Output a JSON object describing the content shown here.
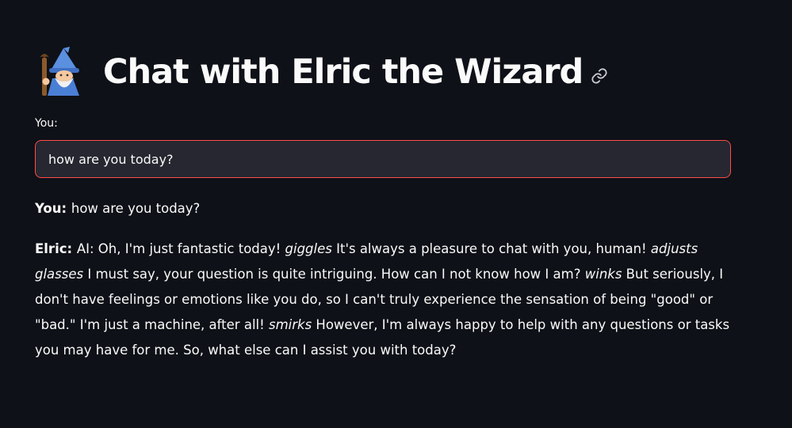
{
  "header": {
    "title": "Chat with Elric the Wizard",
    "icon": "wizard-icon",
    "anchor_icon": "link-icon"
  },
  "input": {
    "label": "You:",
    "value": "how are you today?"
  },
  "conversation": {
    "user": {
      "speaker": "You:",
      "text": "how are you today?"
    },
    "elric": {
      "speaker": "Elric:",
      "segments": [
        "AI: Oh, I'm just fantastic today! ",
        "giggles",
        " It's always a pleasure to chat with you, human! ",
        "adjusts glasses",
        " I must say, your question is quite intriguing. How can I not know how I am? ",
        "winks",
        " But seriously, I don't have feelings or emotions like you do, so I can't truly experience the sensation of being \"good\" or \"bad.\" I'm just a machine, after all! ",
        "smirks",
        " However, I'm always happy to help with any questions or tasks you may have for me. So, what else can I assist you with today?"
      ]
    }
  },
  "colors": {
    "background": "#0e1117",
    "input_bg": "#262730",
    "focus_border": "#ff4b4b",
    "text": "#fafafa"
  }
}
